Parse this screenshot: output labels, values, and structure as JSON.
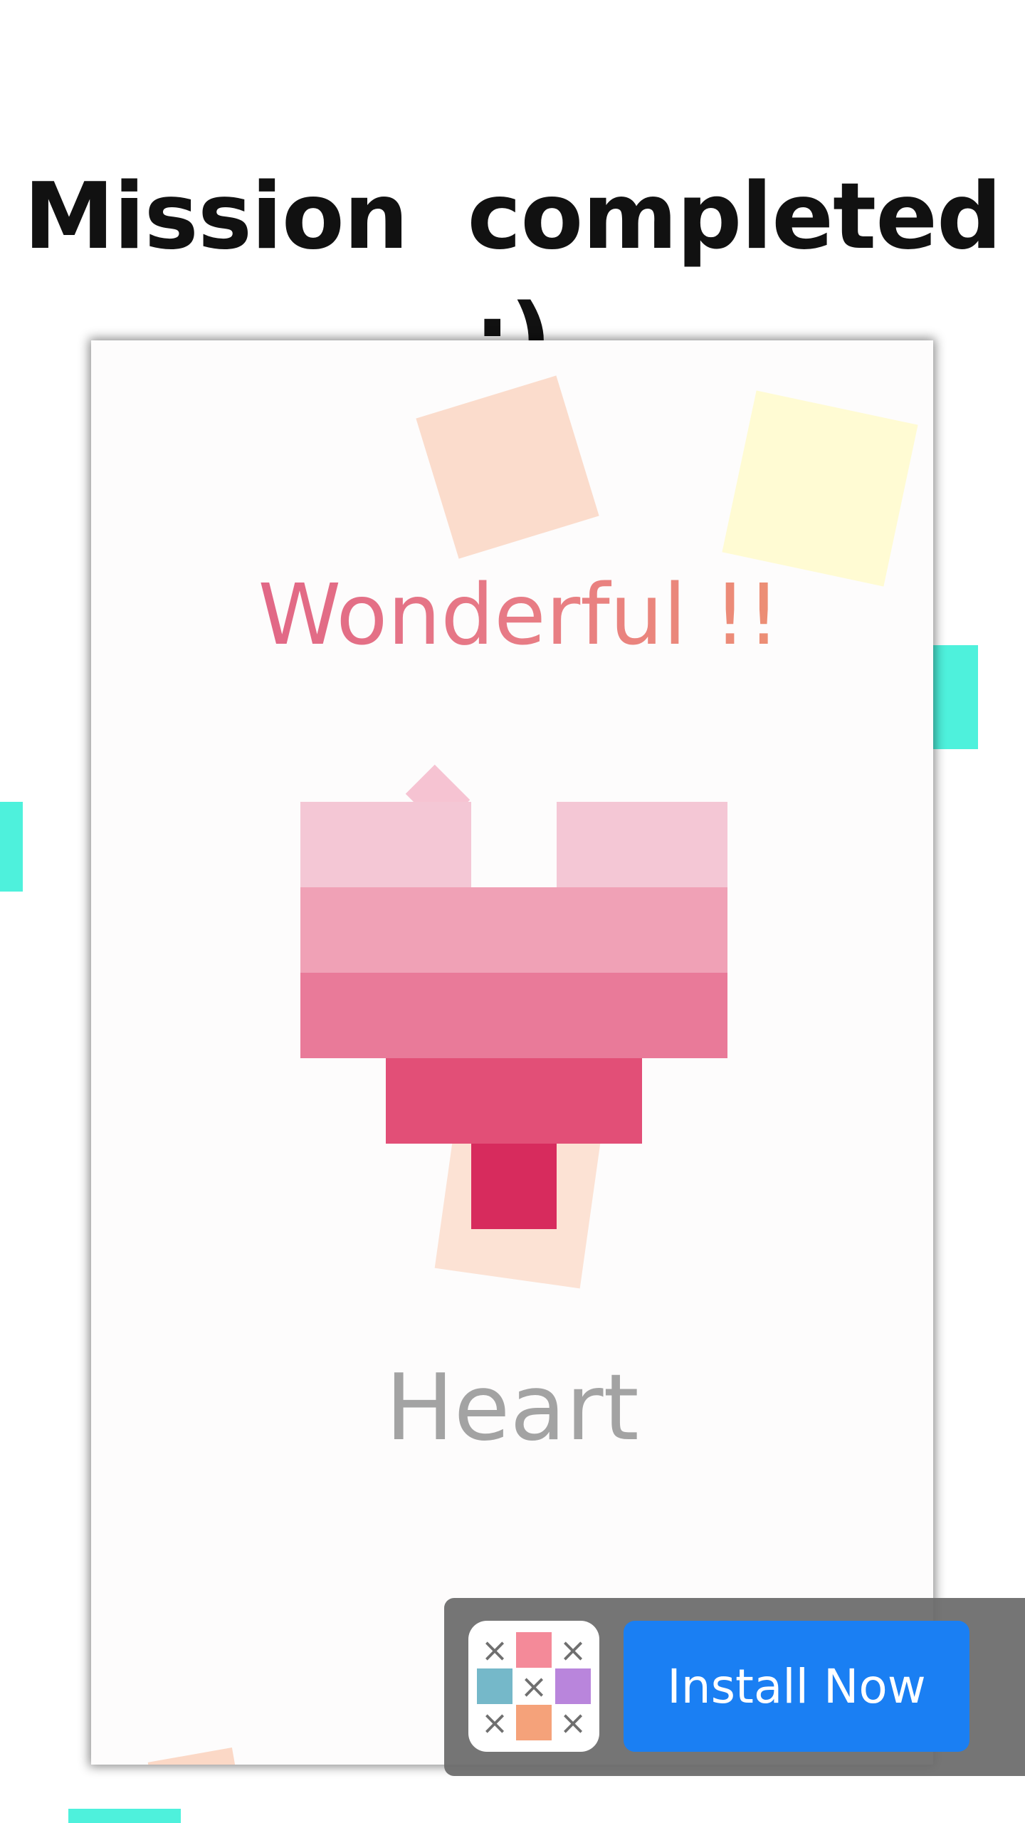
{
  "header": {
    "title": "Mission  completed :)"
  },
  "result_card": {
    "message": "Wonderful !!",
    "puzzle_name": "Heart",
    "message_gradient": [
      "#dd5a86",
      "#f09a6a"
    ]
  },
  "heart_picture": {
    "row_colors": [
      "#f4c7d5",
      "#f0a1b6",
      "#e97a99",
      "#e24f77",
      "#d72b5d"
    ]
  },
  "ad": {
    "install_label": "Install Now",
    "app_icon": "tic-tac-toe-color-grid-icon",
    "app_icon_cells": [
      "×",
      "",
      "×",
      "",
      "×",
      "",
      "×",
      "",
      "×"
    ],
    "app_icon_colors": [
      "#f48a99",
      "#75b8c9",
      "#b985dc",
      "#f5a27a"
    ],
    "button_color": "#1a7ff3"
  },
  "decor": {
    "teal": "#4ef1dc",
    "peach": "#fbd8c6",
    "yellow": "#fffbd3"
  }
}
